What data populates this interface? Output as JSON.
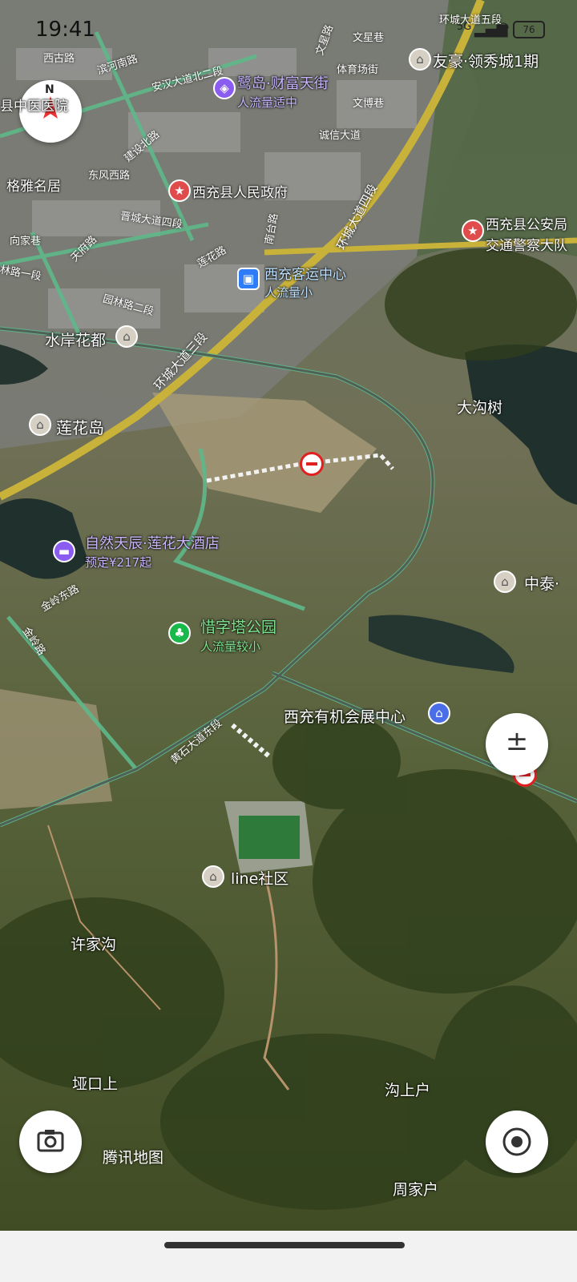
{
  "status_bar": {
    "time": "19:41",
    "battery": "76",
    "network": "5G"
  },
  "roads": {
    "ring_road_5": "环城大道五段",
    "ring_road_4": "环城大道四段",
    "ring_road_3": "环城大道三段",
    "xigu_road": "西古路",
    "anhan_north_2": "安汉大道北二段",
    "binhe_north": "滨河南路",
    "wenhua_lane": "文星巷",
    "wenxing_lane": "文星路",
    "tiyu": "体育场街",
    "jiancheng_north": "建设北路",
    "dongfeng_west": "东风西路",
    "jincheng_4": "晋城大道四段",
    "nantai": "南台路",
    "lianhua": "莲花路",
    "xiangjia": "向家巷",
    "tianfu": "天府路",
    "yuanlin_2": "园林路二段",
    "linlu_1": "林路一段",
    "chengxin": "诚信大道",
    "wenbo": "文博巷",
    "jinling_east": "金岭东路",
    "jinling": "金岭路",
    "huangshi_east": "黄石大道东段"
  },
  "places": {
    "youhao": "友豪·领秀城1期",
    "ludao_name": "鹭岛·财富天街",
    "ludao_status": "人流量适中",
    "county_gov": "西充县人民政府",
    "police_1": "西充县公安局",
    "police_2": "交通警察大队",
    "bus_center_name": "西充客运中心",
    "bus_center_status": "人流量小",
    "shuian": "水岸花都",
    "lianhuadao": "莲花岛",
    "dagoushu": "大沟树",
    "hotel_name": "自然天辰·莲花大酒店",
    "hotel_price": "预定¥217起",
    "zhongtai": "中泰·",
    "park_name": "惜字塔公园",
    "park_status": "人流量较小",
    "expo": "西充有机会展中心",
    "line_community": "line社区",
    "xujiagou": "许家沟",
    "yakoushang": "垭口上",
    "goushanghu": "沟上户",
    "zhoujiahu": "周家户",
    "gexiaming": "格雅名居",
    "hospital": "县中医医院"
  },
  "controls": {
    "compass_letter": "N",
    "zoom_label": "±"
  },
  "watermark": "腾讯地图",
  "colors": {
    "main_road": "#c9b23a",
    "secondary_road": "#5fb88a",
    "road_block": "#e02020",
    "poi_purple": "#8a5cf0"
  }
}
